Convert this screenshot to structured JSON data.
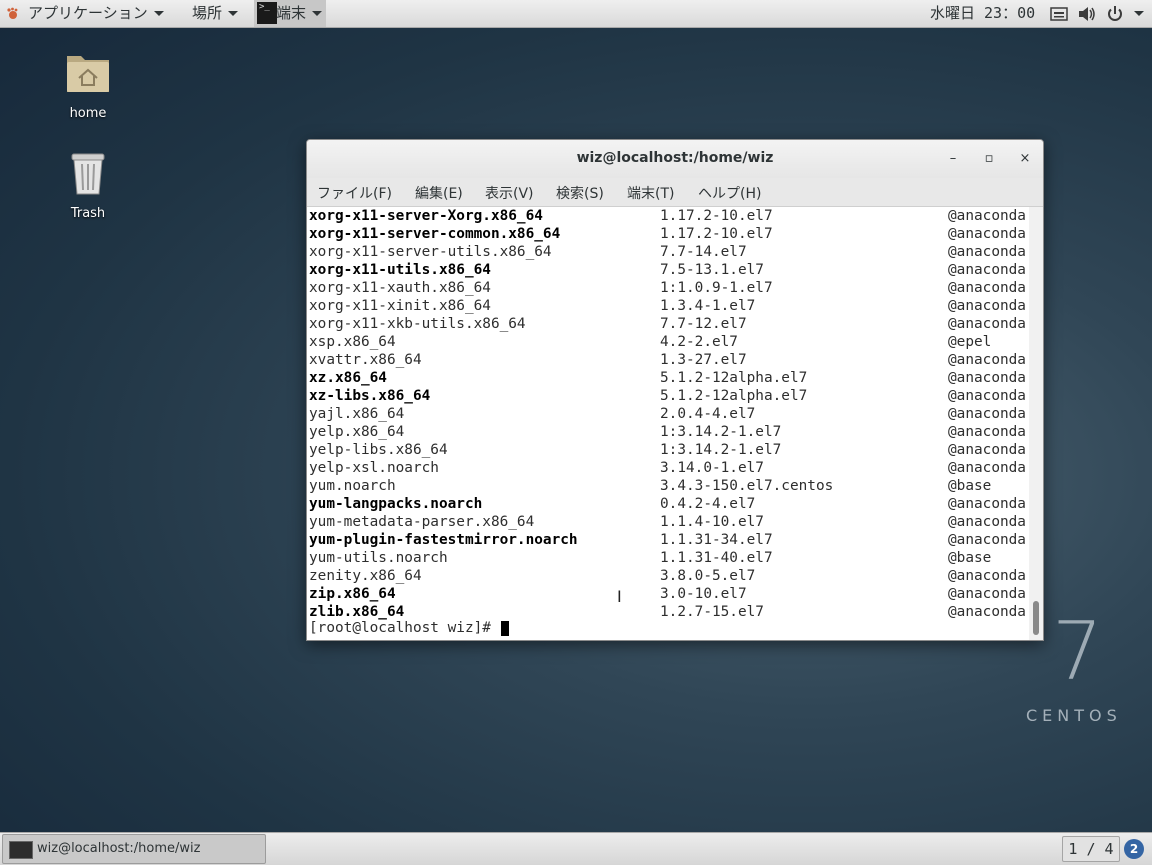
{
  "top_panel": {
    "apps_label": "アプリケーション",
    "places_label": "場所",
    "terminal_label": "端末",
    "clock": "水曜日 23：00"
  },
  "desktop": {
    "home_label": "home",
    "trash_label": "Trash",
    "logo_number": "7",
    "logo_text": "CENTOS"
  },
  "window": {
    "title": "wiz@localhost:/home/wiz",
    "minimize": "–",
    "maximize": "▫",
    "close": "×",
    "menu": [
      "ファイル(F)",
      "編集(E)",
      "表示(V)",
      "検索(S)",
      "端末(T)",
      "ヘルプ(H)"
    ],
    "rows": [
      {
        "pkg": "xorg-x11-server-Xorg.x86_64",
        "ver": "1.17.2-10.el7",
        "repo": "@anaconda",
        "bold": true
      },
      {
        "pkg": "xorg-x11-server-common.x86_64",
        "ver": "1.17.2-10.el7",
        "repo": "@anaconda",
        "bold": true
      },
      {
        "pkg": "xorg-x11-server-utils.x86_64",
        "ver": "7.7-14.el7",
        "repo": "@anaconda",
        "bold": false
      },
      {
        "pkg": "xorg-x11-utils.x86_64",
        "ver": "7.5-13.1.el7",
        "repo": "@anaconda",
        "bold": true
      },
      {
        "pkg": "xorg-x11-xauth.x86_64",
        "ver": "1:1.0.9-1.el7",
        "repo": "@anaconda",
        "bold": false
      },
      {
        "pkg": "xorg-x11-xinit.x86_64",
        "ver": "1.3.4-1.el7",
        "repo": "@anaconda",
        "bold": false
      },
      {
        "pkg": "xorg-x11-xkb-utils.x86_64",
        "ver": "7.7-12.el7",
        "repo": "@anaconda",
        "bold": false
      },
      {
        "pkg": "xsp.x86_64",
        "ver": "4.2-2.el7",
        "repo": "@epel",
        "bold": false
      },
      {
        "pkg": "xvattr.x86_64",
        "ver": "1.3-27.el7",
        "repo": "@anaconda",
        "bold": false
      },
      {
        "pkg": "xz.x86_64",
        "ver": "5.1.2-12alpha.el7",
        "repo": "@anaconda",
        "bold": true
      },
      {
        "pkg": "xz-libs.x86_64",
        "ver": "5.1.2-12alpha.el7",
        "repo": "@anaconda",
        "bold": true
      },
      {
        "pkg": "yajl.x86_64",
        "ver": "2.0.4-4.el7",
        "repo": "@anaconda",
        "bold": false
      },
      {
        "pkg": "yelp.x86_64",
        "ver": "1:3.14.2-1.el7",
        "repo": "@anaconda",
        "bold": false
      },
      {
        "pkg": "yelp-libs.x86_64",
        "ver": "1:3.14.2-1.el7",
        "repo": "@anaconda",
        "bold": false
      },
      {
        "pkg": "yelp-xsl.noarch",
        "ver": "3.14.0-1.el7",
        "repo": "@anaconda",
        "bold": false
      },
      {
        "pkg": "yum.noarch",
        "ver": "3.4.3-150.el7.centos",
        "repo": "@base",
        "bold": false
      },
      {
        "pkg": "yum-langpacks.noarch",
        "ver": "0.4.2-4.el7",
        "repo": "@anaconda",
        "bold": true
      },
      {
        "pkg": "yum-metadata-parser.x86_64",
        "ver": "1.1.4-10.el7",
        "repo": "@anaconda",
        "bold": false
      },
      {
        "pkg": "yum-plugin-fastestmirror.noarch",
        "ver": "1.1.31-34.el7",
        "repo": "@anaconda",
        "bold": true
      },
      {
        "pkg": "yum-utils.noarch",
        "ver": "1.1.31-40.el7",
        "repo": "@base",
        "bold": false
      },
      {
        "pkg": "zenity.x86_64",
        "ver": "3.8.0-5.el7",
        "repo": "@anaconda",
        "bold": false
      },
      {
        "pkg": "zip.x86_64",
        "ver": "3.0-10.el7",
        "repo": "@anaconda",
        "bold": true
      },
      {
        "pkg": "zlib.x86_64",
        "ver": "1.2.7-15.el7",
        "repo": "@anaconda",
        "bold": true
      }
    ],
    "prompt": "[root@localhost wiz]# "
  },
  "bottom_panel": {
    "task_label": "wiz@localhost:/home/wiz",
    "workspace": "1 / 4",
    "notifications": "2"
  },
  "colors": {
    "accent": "#3465a4",
    "panel_bg": "#e4e4e4"
  }
}
